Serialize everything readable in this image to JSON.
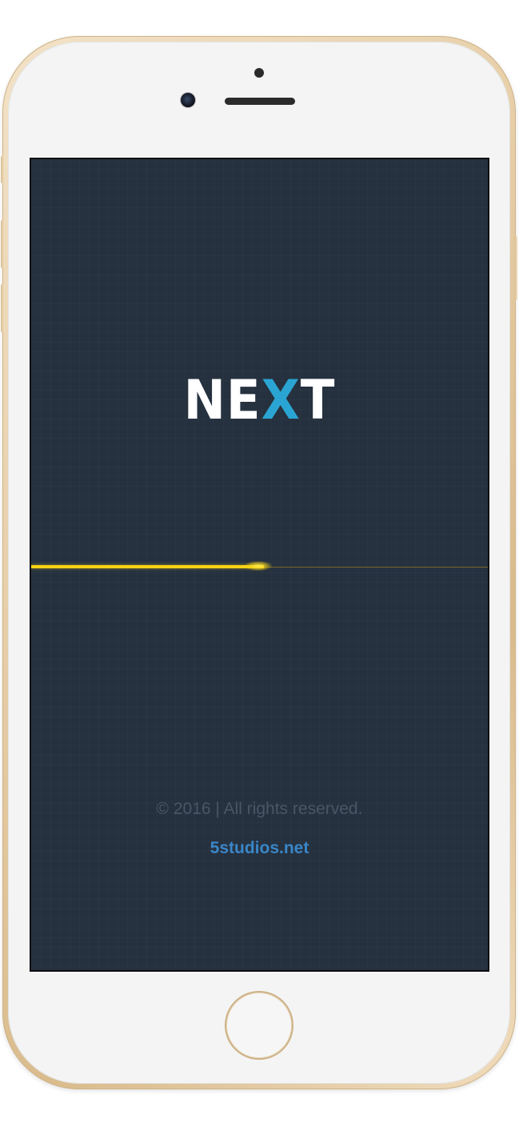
{
  "splash": {
    "logo": {
      "part1": "NE",
      "accent": "X",
      "part2": "T"
    },
    "loading_progress": 0.51,
    "copyright": "© 2016 | All rights reserved.",
    "website": "5studios.net"
  },
  "colors": {
    "background": "#26313f",
    "logo_text": "#ffffff",
    "logo_accent": "#2aa5d3",
    "progress": "#f5d315",
    "copyright_text": "#4a5665",
    "link": "#3a86c8",
    "device_frame": "gold"
  },
  "device": {
    "model": "iPhone",
    "icons": [
      "front-camera-icon",
      "proximity-sensor-icon",
      "earpiece-speaker-icon",
      "home-button-icon"
    ]
  }
}
